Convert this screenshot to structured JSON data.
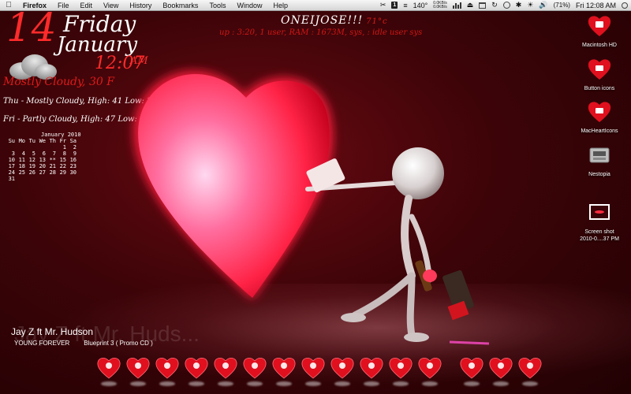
{
  "menubar": {
    "apple_icon": "apple-icon",
    "app_name": "Firefox",
    "menus": [
      "File",
      "Edit",
      "View",
      "History",
      "Bookmarks",
      "Tools",
      "Window",
      "Help"
    ],
    "status": {
      "temperature": "140°",
      "net_up": "0.0KB/s",
      "net_down": "0.0KB/s",
      "keyboard_badge": "1",
      "battery": "(71%)",
      "clock": "Fri 12:08 AM"
    }
  },
  "widgets": {
    "day_number": "14",
    "day_name": "Friday",
    "month_name": "January",
    "time": "12:07",
    "ampm": "AM",
    "conditions": "Mostly Cloudy, 30 F",
    "forecast": [
      "Thu - Mostly Cloudy, High: 41 Low: 27",
      "Fri - Partly Cloudy, High: 47 Low: 31"
    ],
    "calendar": {
      "title": "January 2010",
      "weekdays": [
        "Su",
        "Mo",
        "Tu",
        "We",
        "Th",
        "Fr",
        "Sa"
      ],
      "days": [
        "",
        "",
        "",
        "",
        "",
        "1",
        "2",
        "3",
        "4",
        "5",
        "6",
        "7",
        "8",
        "9",
        "10",
        "11",
        "12",
        "13",
        "**",
        "15",
        "16",
        "17",
        "18",
        "19",
        "20",
        "21",
        "22",
        "23",
        "24",
        "25",
        "26",
        "27",
        "28",
        "29",
        "30",
        "31",
        "",
        "",
        "",
        "",
        "",
        ""
      ]
    },
    "header_title": "ONEIJOSE!!!",
    "header_temp": "71°c",
    "uptime": "up : 3:20, 1 user, RAM : 1673M, sys, : idle user sys"
  },
  "desktop_icons": [
    {
      "label": "Macintosh HD",
      "icon": "hard-drive-heart-icon"
    },
    {
      "label": "Button icons",
      "icon": "folder-heart-icon"
    },
    {
      "label": "MacHeartIcons",
      "icon": "folder-heart-icon"
    },
    {
      "label": "Nestopia",
      "icon": "nestopia-icon"
    },
    {
      "label": "Screen shot\n2010-0....37 PM",
      "icon": "screenshot-file-icon"
    }
  ],
  "now_playing": {
    "song": "Jay Z ft Mr. Hudson",
    "watermark": "Jay Z ft Mr. Huds...",
    "title": "YOUNG FOREVER",
    "album": "Blueprint 3 ( Promo CD )"
  },
  "dock": {
    "items": [
      {
        "icon": "finder-heart-icon"
      },
      {
        "icon": "mail-heart-icon"
      },
      {
        "icon": "safari-heart-icon"
      },
      {
        "icon": "firefox-heart-icon"
      },
      {
        "icon": "photo-heart-icon"
      },
      {
        "icon": "photos-heart-icon"
      },
      {
        "icon": "headphones-heart-icon"
      },
      {
        "icon": "pencil-heart-icon"
      },
      {
        "icon": "video-heart-icon"
      },
      {
        "icon": "dvd-heart-icon"
      },
      {
        "icon": "appstore-heart-icon"
      },
      {
        "icon": "settings-heart-icon"
      }
    ],
    "right_items": [
      {
        "icon": "folder-heart-icon"
      },
      {
        "icon": "downloads-heart-icon"
      },
      {
        "icon": "trash-heart-icon"
      }
    ]
  },
  "colors": {
    "accent_red": "#ff2b2b",
    "heart_red": "#ff2a4a",
    "background": "#3d0408"
  }
}
